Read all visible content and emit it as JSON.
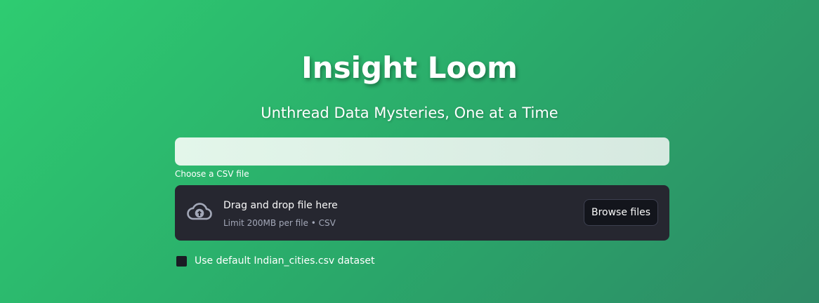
{
  "app": {
    "title": "Insight Loom",
    "subtitle": "Unthread Data Mysteries, One at a Time"
  },
  "top_field": {
    "value": ""
  },
  "uploader": {
    "label": "Choose a CSV file",
    "drop_title": "Drag and drop file here",
    "drop_hint": "Limit 200MB per file • CSV",
    "browse_label": "Browse files",
    "icon": "cloud-upload-icon"
  },
  "default_dataset": {
    "label": "Use default Indian_cities.csv dataset",
    "checked": false
  },
  "colors": {
    "gradient_start": "#2ecc71",
    "gradient_end": "#2e8a66",
    "dropzone_bg": "#262730",
    "button_bg": "#13151c"
  }
}
